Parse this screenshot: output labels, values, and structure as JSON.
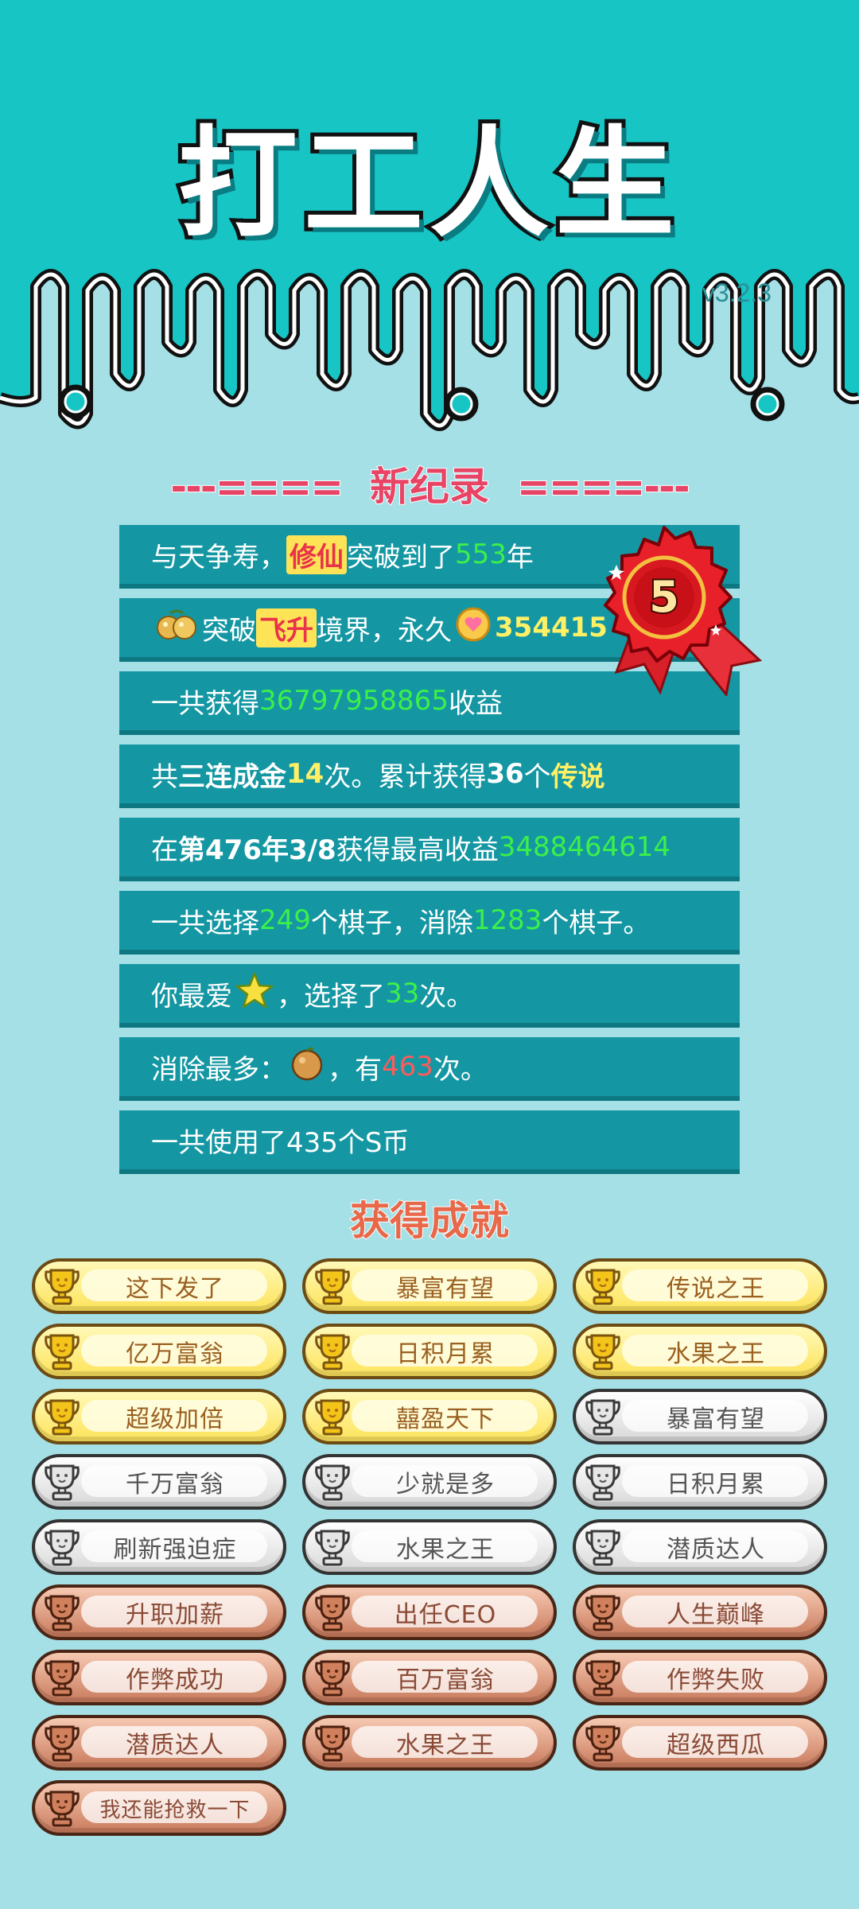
{
  "header": {
    "title": "打工人生",
    "version": "v3.2.3"
  },
  "record_banner": {
    "left_dashes": "---====",
    "text": "新纪录",
    "right_dashes": "====---"
  },
  "badge_rank": "5",
  "stats": {
    "row1": {
      "a": "与天争寿，",
      "hl": "修仙",
      "b": "突破到了",
      "num": "553",
      "c": "年"
    },
    "row2": {
      "a": "突破",
      "hl": "飞升",
      "b": "境界，永久",
      "num": "354415"
    },
    "row3": {
      "a": "一共获得",
      "num": "36797958865",
      "b": "收益"
    },
    "row4": {
      "a": "共",
      "bold": "三连成金",
      "num": "14",
      "b": "次。累计获得",
      "num2": "36",
      "c": "个",
      "legend": "传说"
    },
    "row5": {
      "a": "在 ",
      "bold": "第476年3/8",
      "b": " 获得最高收益",
      "num": "3488464614"
    },
    "row6": {
      "a": "一共选择",
      "num": "249",
      "b": "个棋子，消除",
      "num2": "1283",
      "c": "个棋子。"
    },
    "row7": {
      "a": "你最爱",
      "b": "，选择了",
      "num": "33",
      "c": "次。"
    },
    "row8": {
      "a": "消除最多：",
      "b": "，有",
      "num": "463",
      "c": "次。"
    },
    "row9": {
      "a": "一共使用了435个S币"
    }
  },
  "achievements_title": "获得成就",
  "achievements": [
    {
      "label": "这下发了",
      "tier": "gold"
    },
    {
      "label": "暴富有望",
      "tier": "gold"
    },
    {
      "label": "传说之王",
      "tier": "gold"
    },
    {
      "label": "亿万富翁",
      "tier": "gold"
    },
    {
      "label": "日积月累",
      "tier": "gold"
    },
    {
      "label": "水果之王",
      "tier": "gold"
    },
    {
      "label": "超级加倍",
      "tier": "gold"
    },
    {
      "label": "囍盈天下",
      "tier": "gold"
    },
    {
      "label": "暴富有望",
      "tier": "silver"
    },
    {
      "label": "千万富翁",
      "tier": "silver"
    },
    {
      "label": "少就是多",
      "tier": "silver"
    },
    {
      "label": "日积月累",
      "tier": "silver"
    },
    {
      "label": "刷新强迫症",
      "tier": "silver"
    },
    {
      "label": "水果之王",
      "tier": "silver"
    },
    {
      "label": "潜质达人",
      "tier": "silver"
    },
    {
      "label": "升职加薪",
      "tier": "bronze"
    },
    {
      "label": "出任CEO",
      "tier": "bronze"
    },
    {
      "label": "人生巅峰",
      "tier": "bronze"
    },
    {
      "label": "作弊成功",
      "tier": "bronze"
    },
    {
      "label": "百万富翁",
      "tier": "bronze"
    },
    {
      "label": "作弊失败",
      "tier": "bronze"
    },
    {
      "label": "潜质达人",
      "tier": "bronze"
    },
    {
      "label": "水果之王",
      "tier": "bronze"
    },
    {
      "label": "超级西瓜",
      "tier": "bronze"
    },
    {
      "label": "我还能抢救一下",
      "tier": "bronze"
    }
  ],
  "colors": {
    "header_teal": "#17c5c5",
    "background": "#a4e0e5",
    "row": "#1497a3",
    "green": "#3cf04a",
    "yellow": "#fff066",
    "red": "#ff5b5b",
    "banner_pink": "#e84466"
  },
  "icons": {
    "row2_fruit": "longan-fruit-icon",
    "row2_coin": "heart-coin-icon",
    "row7": "star-icon",
    "row8": "orange-fruit-icon",
    "rosette": "award-rosette-icon",
    "trophy": "trophy-icon"
  }
}
